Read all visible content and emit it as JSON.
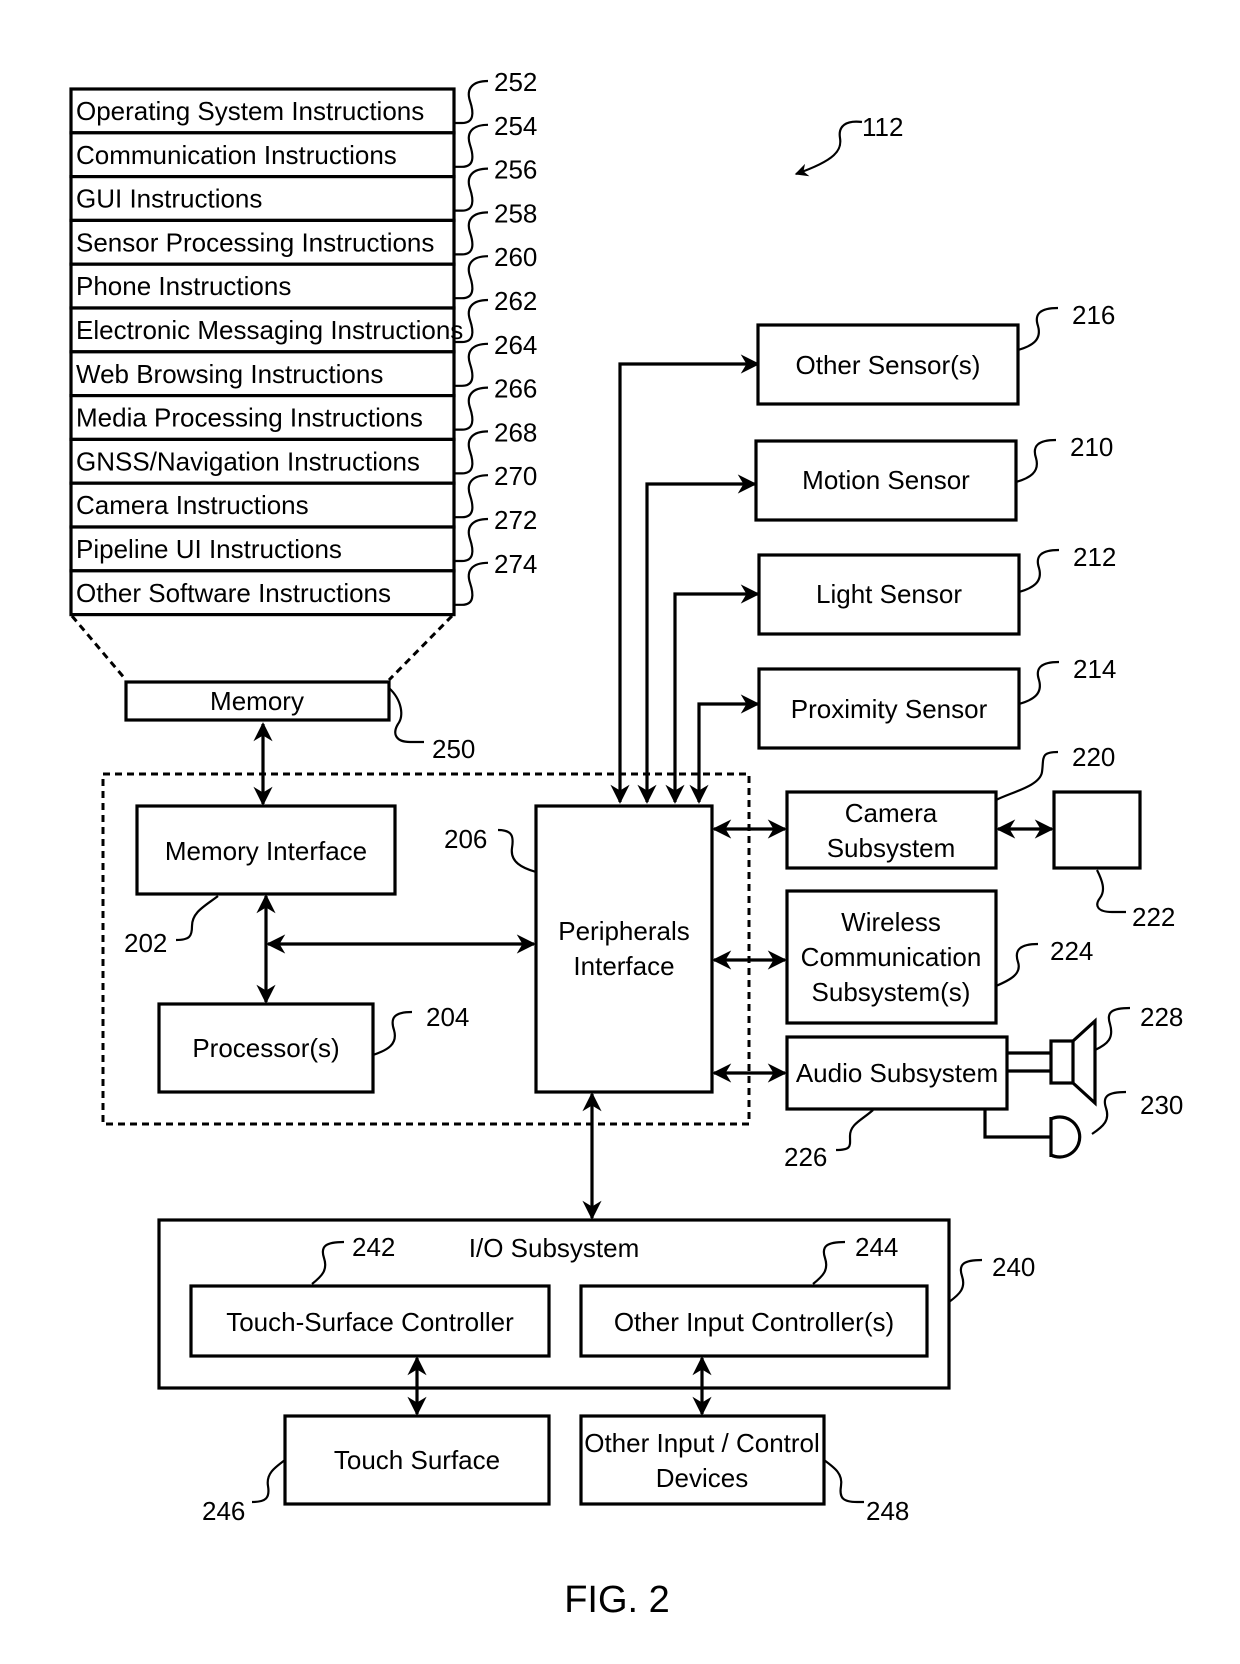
{
  "figure": {
    "caption": "FIG. 2",
    "device_ref": "112"
  },
  "software_stack": {
    "items": [
      {
        "label": "Operating System Instructions",
        "ref": "252"
      },
      {
        "label": "Communication Instructions",
        "ref": "254"
      },
      {
        "label": "GUI Instructions",
        "ref": "256"
      },
      {
        "label": "Sensor Processing Instructions",
        "ref": "258"
      },
      {
        "label": "Phone Instructions",
        "ref": "260"
      },
      {
        "label": "Electronic Messaging Instructions",
        "ref": "262"
      },
      {
        "label": "Web Browsing Instructions",
        "ref": "264"
      },
      {
        "label": "Media Processing Instructions",
        "ref": "266"
      },
      {
        "label": "GNSS/Navigation Instructions",
        "ref": "268"
      },
      {
        "label": "Camera Instructions",
        "ref": "270"
      },
      {
        "label": "Pipeline UI Instructions",
        "ref": "272"
      },
      {
        "label": "Other Software Instructions",
        "ref": "274"
      }
    ]
  },
  "blocks": {
    "memory": {
      "label": "Memory",
      "ref": "250"
    },
    "memory_interface": {
      "label": "Memory Interface",
      "ref": "202"
    },
    "processor": {
      "label": "Processor(s)",
      "ref": "204"
    },
    "peripherals_interface": {
      "line1": "Peripherals",
      "line2": "Interface",
      "ref": "206"
    },
    "other_sensors": {
      "label": "Other Sensor(s)",
      "ref": "216"
    },
    "motion_sensor": {
      "label": "Motion Sensor",
      "ref": "210"
    },
    "light_sensor": {
      "label": "Light Sensor",
      "ref": "212"
    },
    "proximity_sensor": {
      "label": "Proximity Sensor",
      "ref": "214"
    },
    "camera_subsystem": {
      "line1": "Camera",
      "line2": "Subsystem",
      "ref": "220"
    },
    "camera_sensor": {
      "ref": "222"
    },
    "wireless": {
      "line1": "Wireless",
      "line2": "Communication",
      "line3": "Subsystem(s)",
      "ref": "224"
    },
    "audio_subsystem": {
      "label": "Audio Subsystem",
      "ref": "226"
    },
    "speaker": {
      "ref": "228"
    },
    "microphone": {
      "ref": "230"
    },
    "io_subsystem": {
      "label": "I/O Subsystem",
      "ref": "240"
    },
    "touch_controller": {
      "label": "Touch-Surface Controller",
      "ref": "242"
    },
    "other_input_controller": {
      "label": "Other Input Controller(s)",
      "ref": "244"
    },
    "touch_surface": {
      "label": "Touch Surface",
      "ref": "246"
    },
    "other_input_devices": {
      "line1": "Other Input / Control",
      "line2": "Devices",
      "ref": "248"
    }
  }
}
